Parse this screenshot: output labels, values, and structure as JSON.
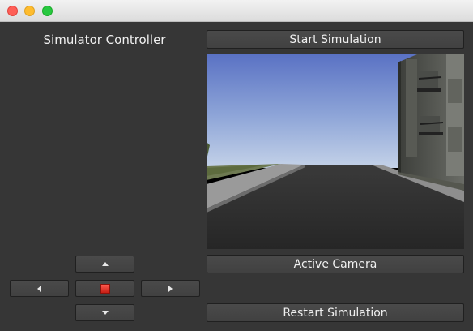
{
  "window": {
    "traffic_lights": [
      {
        "name": "close",
        "color": "#fe5f57"
      },
      {
        "name": "minimize",
        "color": "#febc2e"
      },
      {
        "name": "maximize",
        "color": "#28c840"
      }
    ]
  },
  "controller": {
    "title": "Simulator Controller",
    "dpad": {
      "up_icon": "triangle-up-icon",
      "down_icon": "triangle-down-icon",
      "left_icon": "triangle-left-icon",
      "right_icon": "triangle-right-icon",
      "stop_icon": "red-square-stop-icon",
      "stop_color": "#e0281e"
    }
  },
  "buttons": {
    "start": "Start Simulation",
    "camera": "Active Camera",
    "restart": "Restart Simulation"
  },
  "camera_view": {
    "sky_top": "#5a72c4",
    "sky_horizon": "#c4d2e8",
    "road_color": "#2c2c2c",
    "sidewalk_color": "#9a9a9a"
  }
}
